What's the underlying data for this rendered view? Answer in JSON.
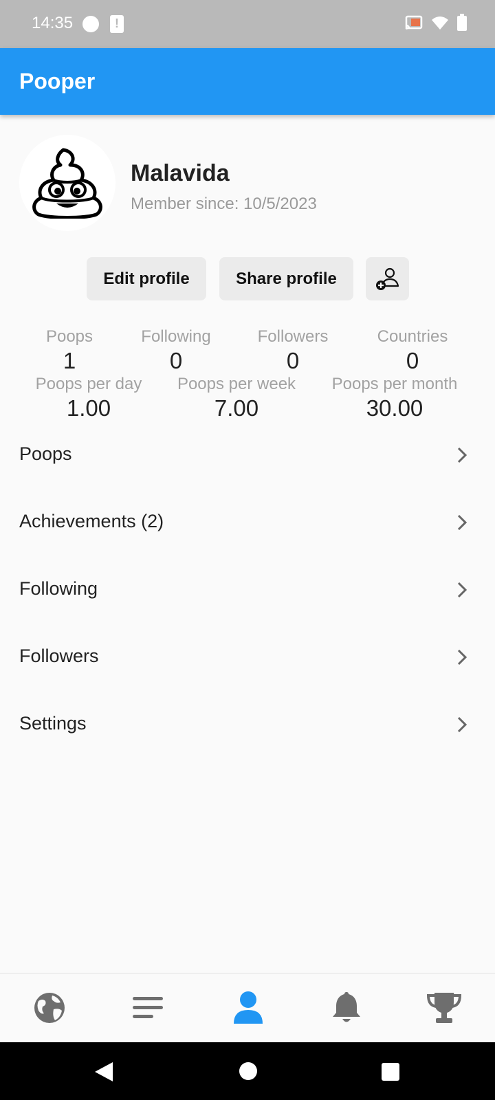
{
  "status_bar": {
    "time": "14:35"
  },
  "app_bar": {
    "title": "Pooper"
  },
  "profile": {
    "username": "Malavida",
    "member_since": "Member since: 10/5/2023"
  },
  "buttons": {
    "edit_label": "Edit profile",
    "share_label": "Share profile",
    "add_friend_icon": "add-person-icon"
  },
  "stats": {
    "row1": [
      {
        "label": "Poops",
        "value": "1"
      },
      {
        "label": "Following",
        "value": "0"
      },
      {
        "label": "Followers",
        "value": "0"
      },
      {
        "label": "Countries",
        "value": "0"
      }
    ],
    "row2": [
      {
        "label": "Poops per day",
        "value": "1.00"
      },
      {
        "label": "Poops per week",
        "value": "7.00"
      },
      {
        "label": "Poops per month",
        "value": "30.00"
      }
    ]
  },
  "menu": [
    {
      "label": "Poops"
    },
    {
      "label": "Achievements (2)"
    },
    {
      "label": "Following"
    },
    {
      "label": "Followers"
    },
    {
      "label": "Settings"
    }
  ],
  "bottom_nav": [
    {
      "icon": "globe-icon",
      "active": false
    },
    {
      "icon": "menu-icon",
      "active": false
    },
    {
      "icon": "person-icon",
      "active": true
    },
    {
      "icon": "bell-icon",
      "active": false
    },
    {
      "icon": "trophy-icon",
      "active": false
    }
  ],
  "colors": {
    "primary": "#2196f3",
    "status_bar": "#b9b9b9",
    "nav_inactive": "#6e6e6e",
    "nav_active": "#2196f3"
  }
}
